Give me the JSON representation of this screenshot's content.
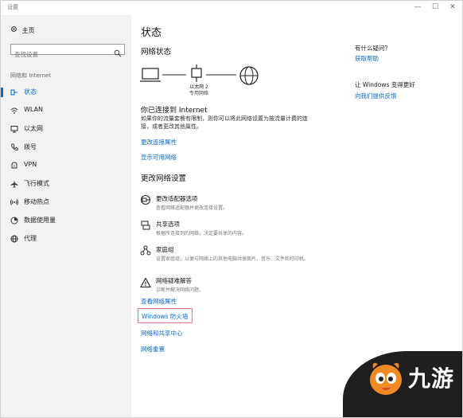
{
  "window": {
    "title": "设置",
    "controls": [
      "—",
      "☐",
      "✕"
    ]
  },
  "sidebar": {
    "home_label": "主页",
    "search_placeholder": "查找设置",
    "section_title": "网络和 Internet",
    "items": [
      {
        "label": "状态",
        "icon": "status-icon",
        "active": true
      },
      {
        "label": "WLAN",
        "icon": "wifi-icon"
      },
      {
        "label": "以太网",
        "icon": "ethernet-icon"
      },
      {
        "label": "拨号",
        "icon": "dialup-icon"
      },
      {
        "label": "VPN",
        "icon": "vpn-icon"
      },
      {
        "label": "飞行模式",
        "icon": "airplane-icon"
      },
      {
        "label": "移动热点",
        "icon": "hotspot-icon"
      },
      {
        "label": "数据使用量",
        "icon": "data-usage-icon"
      },
      {
        "label": "代理",
        "icon": "proxy-icon"
      }
    ]
  },
  "main": {
    "page_title": "状态",
    "network_status_title": "网络状态",
    "diagram": {
      "adapter_name": "以太网 2",
      "network_type": "专用网络"
    },
    "connected_title": "你已连接到 Internet",
    "connected_desc": "如果你的流量套餐有限制，则你可以将此网络设置为按流量计费的连接，或者更改其他属性。",
    "change_props_link": "更改连接属性",
    "show_networks_link": "显示可用网络",
    "change_settings_title": "更改网络设置",
    "options": [
      {
        "title": "更改适配器选项",
        "desc": "查看网络适配器并更改连接设置。",
        "icon": "adapter-icon"
      },
      {
        "title": "共享选项",
        "desc": "根据所连接到的网络，决定要共享的内容。",
        "icon": "sharing-icon"
      },
      {
        "title": "家庭组",
        "desc": "设置家庭组，以便与网络上的其他电脑共享图片、音乐、文件和打印机。",
        "icon": "homegroup-icon"
      },
      {
        "title": "网络疑难解答",
        "desc": "诊断并解决网络问题。",
        "icon": "warning-icon"
      }
    ],
    "view_props_link": "查看网络属性",
    "firewall_link": "Windows 防火墙",
    "sharing_center_link": "网络和共享中心",
    "network_reset_link": "网络重置"
  },
  "right_panel": {
    "question": "有什么疑问？",
    "get_help": "获取帮助",
    "improve": "让 Windows 变得更好",
    "feedback": "向我们提供反馈"
  },
  "watermark": {
    "text": "九游"
  },
  "colors": {
    "accent": "#0a6bc2",
    "sidebar_bg": "#f2f2f2",
    "highlight_border": "#e57c7c"
  }
}
